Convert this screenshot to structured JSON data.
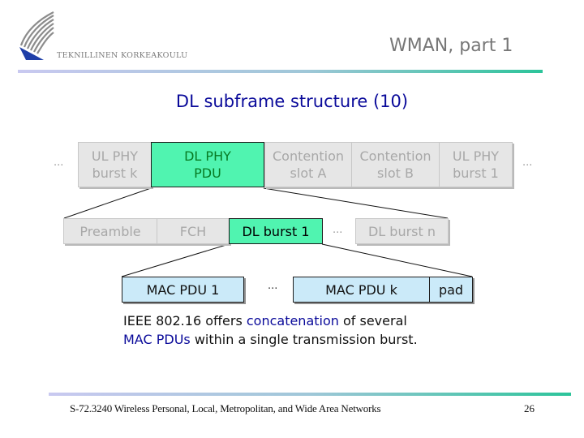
{
  "header": {
    "institution": "TEKNILLINEN KORKEAKOULU",
    "title": "WMAN, part 1"
  },
  "slide": {
    "title": "DL subframe structure (10)"
  },
  "colors": {
    "title_blue": "#0a0a9a",
    "highlight_green": "#50f4b0",
    "mac_blue": "#cbeaf9",
    "inactive_grey": "#e6e6e6"
  },
  "diagram": {
    "frame_row": {
      "leading_ellipsis": "...",
      "trailing_ellipsis": "...",
      "cells": [
        {
          "line1": "UL PHY",
          "line2": "burst k",
          "highlighted": false
        },
        {
          "line1": "DL PHY",
          "line2": "PDU",
          "highlighted": true
        },
        {
          "line1": "Contention",
          "line2": "slot A",
          "highlighted": false
        },
        {
          "line1": "Contention",
          "line2": "slot B",
          "highlighted": false
        },
        {
          "line1": "UL PHY",
          "line2": "burst 1",
          "highlighted": false
        }
      ]
    },
    "pdu_row": {
      "cells": [
        {
          "label": "Preamble",
          "highlighted": false
        },
        {
          "label": "FCH",
          "highlighted": false
        },
        {
          "label": "DL burst 1",
          "highlighted": true
        }
      ],
      "ellipsis": "...",
      "last": {
        "label": "DL burst n",
        "highlighted": false
      }
    },
    "burst_row": {
      "first": {
        "label": "MAC PDU 1"
      },
      "ellipsis": "...",
      "last": {
        "label": "MAC PDU k"
      },
      "pad": {
        "label": "pad"
      }
    }
  },
  "description": {
    "part1": "IEEE 802.16 offers ",
    "highlight1": "concatenation",
    "part2": " of several",
    "highlight2": "MAC PDUs",
    "part3": " within a single transmission burst."
  },
  "footer": {
    "course": "S-72.3240 Wireless Personal, Local, Metropolitan, and Wide Area Networks",
    "page_number": "26"
  }
}
